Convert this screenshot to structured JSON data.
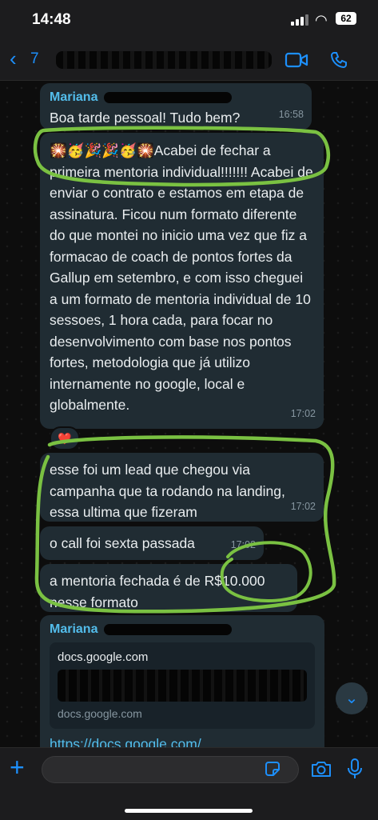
{
  "status_bar": {
    "time": "14:48",
    "battery": "62"
  },
  "header": {
    "back_count": "7"
  },
  "colors": {
    "accent": "#1d8ffb",
    "bubble": "#202c33",
    "sender": "#53bdeb",
    "highlight": "#7ac142"
  },
  "messages": [
    {
      "sender": "Mariana",
      "text": "Boa tarde pessoal! Tudo bem?",
      "time": "16:58"
    },
    {
      "text": "🎇🥳🎉🎉🥳🎇Acabei de fechar a primeira mentoria individual!!!!!!! Acabei de enviar o contrato e estamos em etapa de assinatura. Ficou num formato diferente do que montei no inicio uma vez que fiz a formacao de coach de pontos fortes da Gallup em setembro, e com isso cheguei a um formato de mentoria individual de 10 sessoes, 1 hora cada, para focar no desenvolvimento com base nos pontos fortes, metodologia que já utilizo internamente no google, local e globalmente.",
      "time": "17:02",
      "reaction": "❤️"
    },
    {
      "text": "esse foi um lead que chegou via campanha que ta rodando na landing, essa ultima que fizeram",
      "time": "17:02"
    },
    {
      "text": "o call foi sexta passada",
      "time": "17:02"
    },
    {
      "text": "a mentoria fechada é de R$10.000 nesse formato"
    },
    {
      "sender": "Mariana",
      "preview_title": "docs.google.com",
      "preview_domain": "docs.google.com",
      "link": "https://docs.google.com/"
    }
  ]
}
